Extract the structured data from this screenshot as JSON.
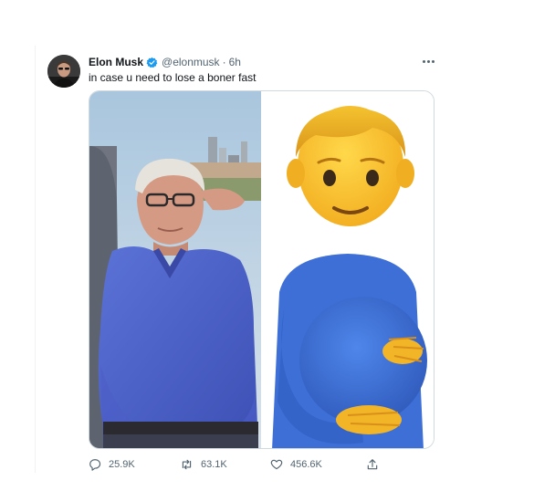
{
  "tweet": {
    "author_name": "Elon Musk",
    "handle": "@elonmusk",
    "separator": "·",
    "time": "6h",
    "text": "in case u need to lose a boner fast"
  },
  "icons": {
    "verified": "verified-badge-icon",
    "more": "more-options-icon",
    "reply": "reply-icon",
    "retweet": "retweet-icon",
    "like": "heart-icon",
    "share": "share-icon"
  },
  "stats": {
    "replies": "25.9K",
    "retweets": "63.1K",
    "likes": "456.6K"
  },
  "colors": {
    "verified": "#1d9bf0",
    "secondary_text": "#536471",
    "primary_text": "#0f1419",
    "border": "#cfd9de",
    "emoji_skin": "#f7c02a",
    "emoji_shirt": "#3d6fd6"
  }
}
